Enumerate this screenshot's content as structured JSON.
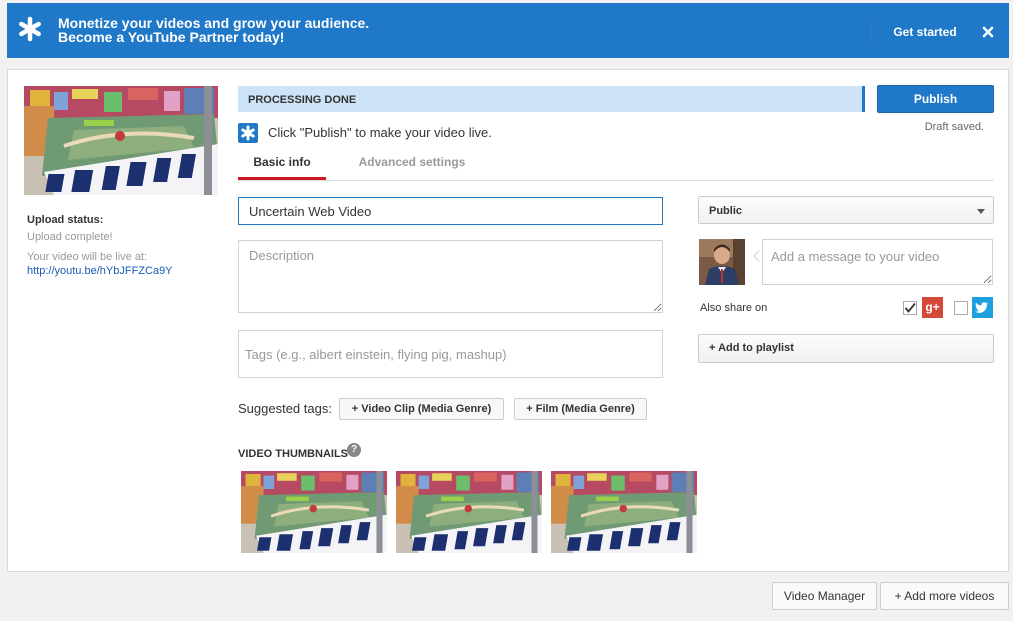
{
  "banner": {
    "line1": "Monetize your videos and grow your audience.",
    "line2": "Become a YouTube Partner today!",
    "cta": "Get started",
    "star_icon": "star-icon",
    "close_icon": "close-icon",
    "color": "#1f78c8"
  },
  "sidebar": {
    "status_title": "Upload status:",
    "status": "Upload complete!",
    "live_label": "Your video will be live at:",
    "link": "http://youtu.be/hYbJFFZCa9Y"
  },
  "processing": {
    "label": "PROCESSING DONE",
    "publish": "Publish",
    "draft": "Draft saved.",
    "hint": "Click \"Publish\" to make your video live."
  },
  "tabs": [
    {
      "label": "Basic info",
      "active": true
    },
    {
      "label": "Advanced settings",
      "active": false
    }
  ],
  "form": {
    "title_value": "Uncertain Web Video",
    "description_placeholder": "Description",
    "tags_placeholder": "Tags (e.g., albert einstein, flying pig, mashup)",
    "suggested_label": "Suggested tags:",
    "suggested": [
      "+ Video Clip (Media Genre)",
      "+ Film (Media Genre)"
    ],
    "thumbnails_label": "VIDEO THUMBNAILS",
    "help_glyph": "?"
  },
  "side": {
    "privacy": "Public",
    "message_placeholder": "Add a message to your video",
    "share_label": "Also share on",
    "gplus_label": "g+",
    "google_checked": true,
    "twitter_checked": false,
    "playlist": "+ Add to playlist"
  },
  "footer": {
    "video_manager": "Video Manager",
    "add_more": "+ Add more videos"
  }
}
